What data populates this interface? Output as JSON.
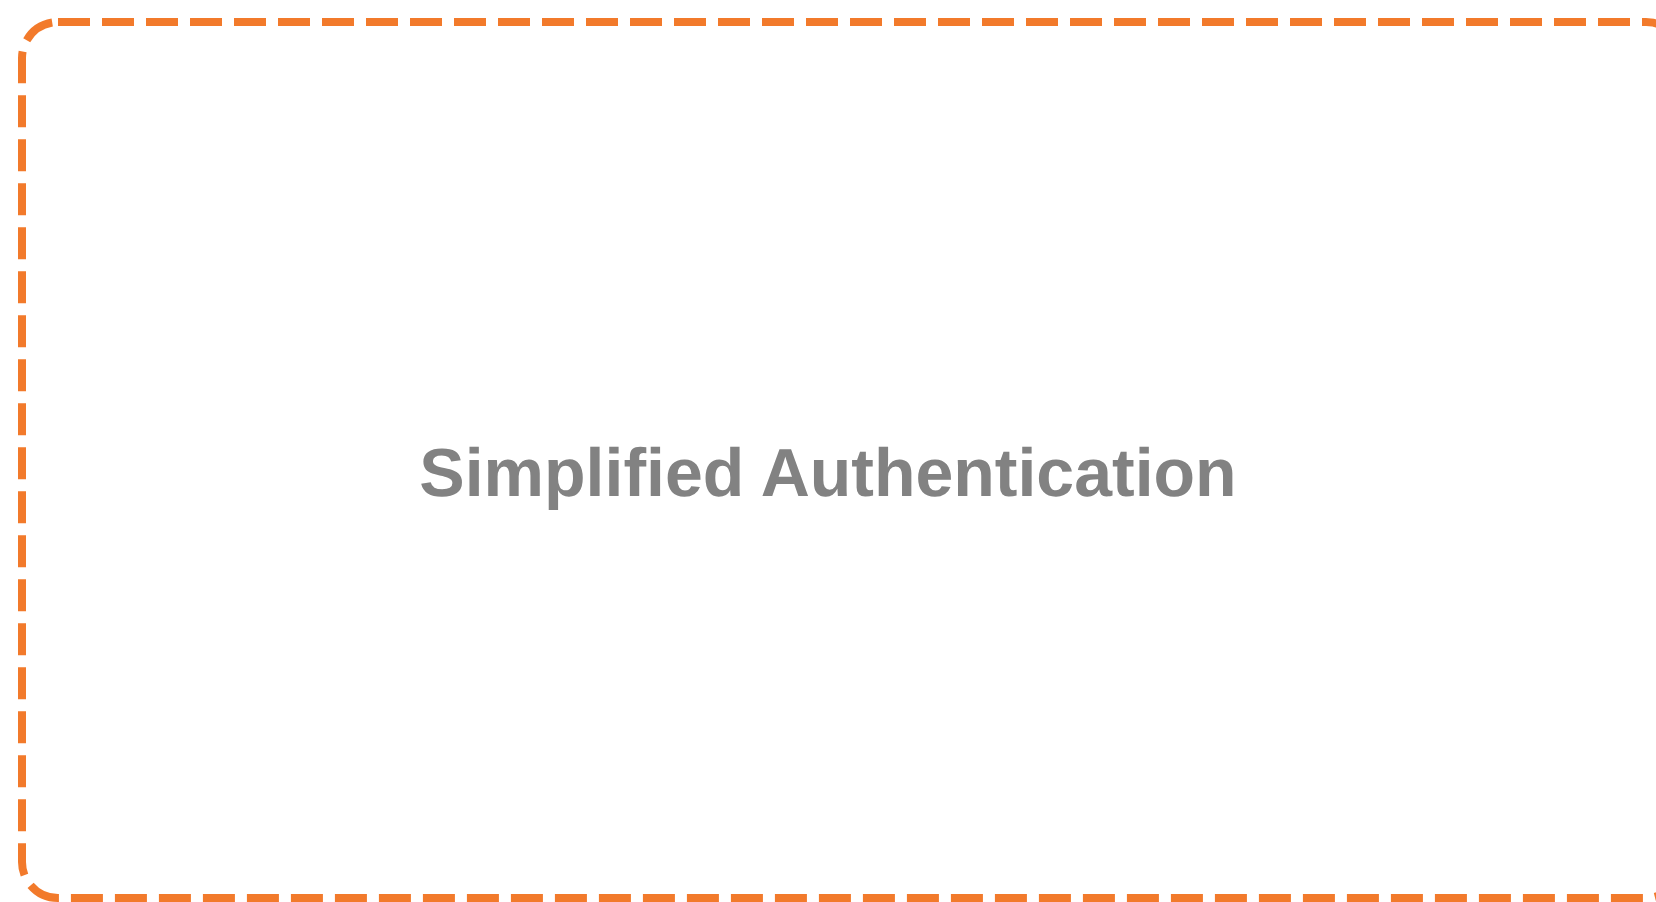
{
  "card": {
    "title": "Simplified Authentication"
  }
}
